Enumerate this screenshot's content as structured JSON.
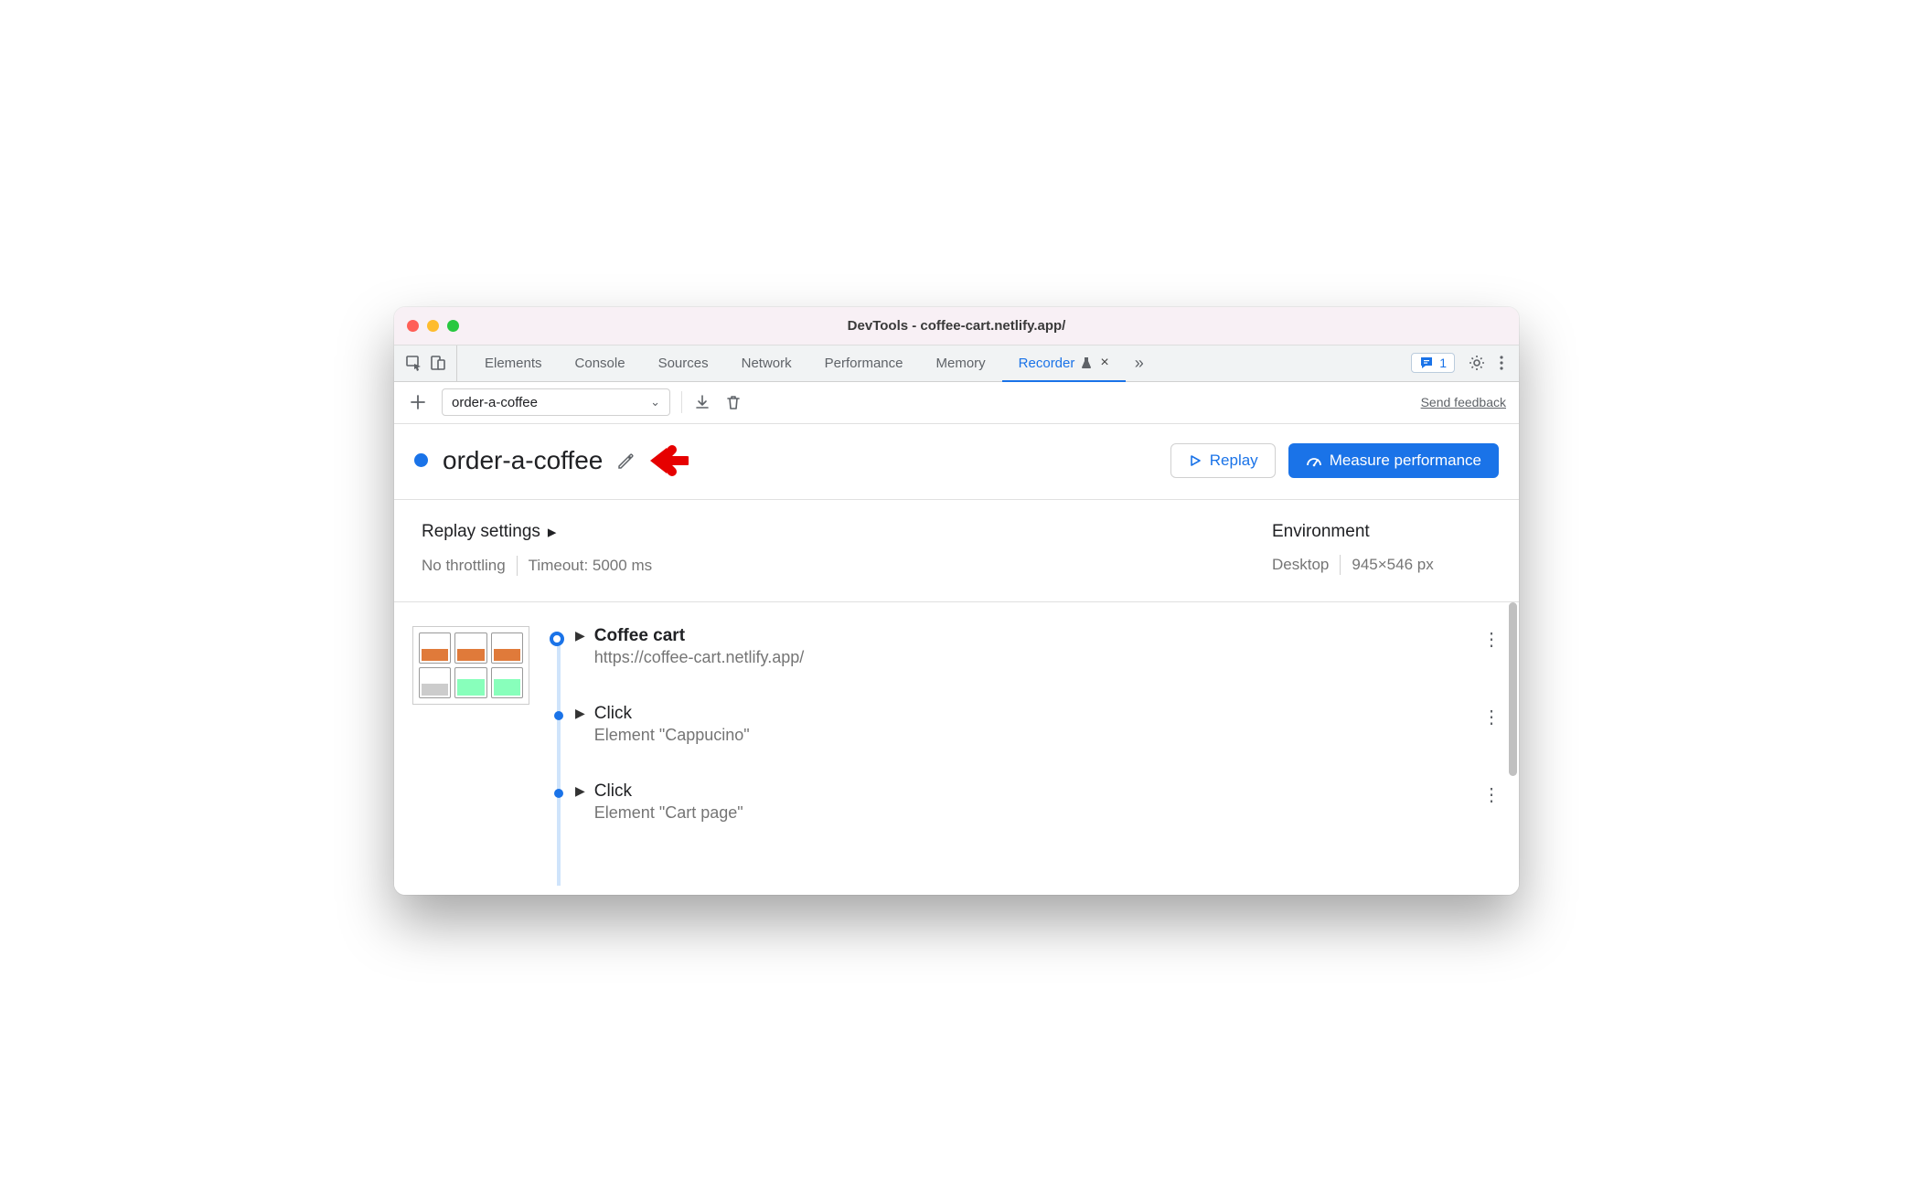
{
  "window_title": "DevTools - coffee-cart.netlify.app/",
  "tabs": [
    {
      "label": "Elements"
    },
    {
      "label": "Console"
    },
    {
      "label": "Sources"
    },
    {
      "label": "Network"
    },
    {
      "label": "Performance"
    },
    {
      "label": "Memory"
    },
    {
      "label": "Recorder",
      "active": true
    }
  ],
  "issues_count": "1",
  "toolbar": {
    "recording_dropdown_value": "order-a-coffee",
    "send_feedback": "Send feedback"
  },
  "header": {
    "title": "order-a-coffee",
    "replay_label": "Replay",
    "measure_label": "Measure performance"
  },
  "settings": {
    "replay_heading": "Replay settings",
    "throttling": "No throttling",
    "timeout": "Timeout: 5000 ms",
    "env_heading": "Environment",
    "env_device": "Desktop",
    "env_size": "945×546 px"
  },
  "steps": [
    {
      "title": "Coffee cart",
      "sub": "https://coffee-cart.netlify.app/",
      "first": true
    },
    {
      "title": "Click",
      "sub": "Element \"Cappucino\""
    },
    {
      "title": "Click",
      "sub": "Element \"Cart page\""
    }
  ]
}
